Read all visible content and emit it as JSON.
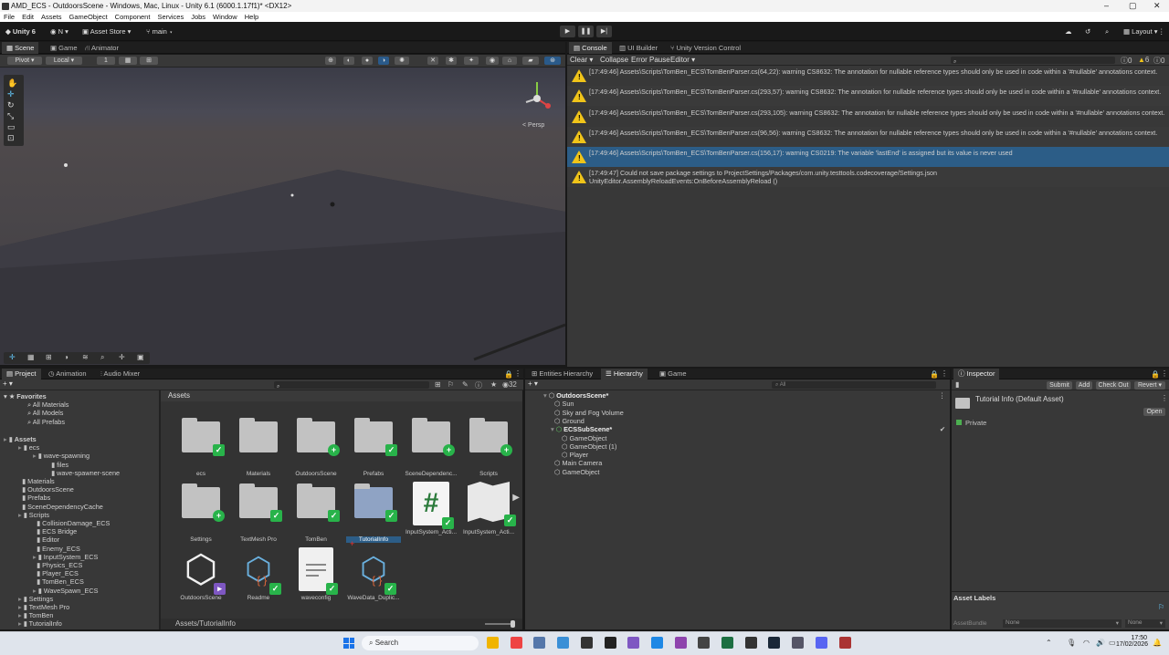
{
  "window": {
    "title": "AMD_ECS - OutdoorsScene - Windows, Mac, Linux - Unity 6.1 (6000.1.17f1)* <DX12>"
  },
  "menu": [
    "File",
    "Edit",
    "Assets",
    "GameObject",
    "Component",
    "Services",
    "Jobs",
    "Window",
    "Help"
  ],
  "toolbar": {
    "unity": "Unity 6",
    "account": "N",
    "asset_store": "Asset Store",
    "branch": "main",
    "layout": "Layout"
  },
  "scene_tabs": [
    "Scene",
    "Game",
    "Animator"
  ],
  "scene_toolbar": {
    "pivot": "Pivot",
    "local": "Local",
    "grid_num": "1",
    "persp": "< Persp"
  },
  "console_tabs": [
    "Console",
    "UI Builder",
    "Unity Version Control"
  ],
  "console_toolbar": {
    "clear": "Clear",
    "collapse": "Collapse",
    "error_pause": "Error Pause",
    "editor": "Editor",
    "err_count": "0",
    "warn_count": "6",
    "info_count": "0"
  },
  "console_rows": [
    {
      "line1": "[17:49:46] Assets\\Scripts\\TomBen_ECS\\TomBenParser.cs(64,22): warning CS8632: The annotation for nullable reference types should only be used in code within a '#nullable' annotations context.",
      "line2": ""
    },
    {
      "line1": "[17:49:46] Assets\\Scripts\\TomBen_ECS\\TomBenParser.cs(293,57): warning CS8632: The annotation for nullable reference types should only be used in code within a '#nullable' annotations context.",
      "line2": ""
    },
    {
      "line1": "[17:49:46] Assets\\Scripts\\TomBen_ECS\\TomBenParser.cs(293,105): warning CS8632: The annotation for nullable reference types should only be used in code within a '#nullable' annotations context.",
      "line2": ""
    },
    {
      "line1": "[17:49:46] Assets\\Scripts\\TomBen_ECS\\TomBenParser.cs(96,56): warning CS8632: The annotation for nullable reference types should only be used in code within a '#nullable' annotations context.",
      "line2": ""
    },
    {
      "line1": "[17:49:46] Assets\\Scripts\\TomBen_ECS\\TomBenParser.cs(156,17): warning CS0219: The variable 'lastEnd' is assigned but its value is never used",
      "line2": ""
    },
    {
      "line1": "[17:49:47] Could not save package settings to ProjectSettings/Packages/com.unity.testtools.codecoverage/Settings.json",
      "line2": "UnityEditor.AssemblyReloadEvents:OnBeforeAssemblyReload ()"
    }
  ],
  "project_tabs": [
    "Project",
    "Animation",
    "Audio Mixer"
  ],
  "favorites": {
    "label": "Favorites",
    "items": [
      "All Materials",
      "All Models",
      "All Prefabs"
    ]
  },
  "tree": [
    {
      "label": "Assets",
      "depth": 0
    },
    {
      "label": "ecs",
      "depth": 1
    },
    {
      "label": "wave-spawning",
      "depth": 2
    },
    {
      "label": "files",
      "depth": 3
    },
    {
      "label": "wave-spawner-scene",
      "depth": 3
    },
    {
      "label": "Materials",
      "depth": 1
    },
    {
      "label": "OutdoorsScene",
      "depth": 1
    },
    {
      "label": "Prefabs",
      "depth": 1
    },
    {
      "label": "SceneDependencyCache",
      "depth": 1
    },
    {
      "label": "Scripts",
      "depth": 1
    },
    {
      "label": "CollisionDamage_ECS",
      "depth": 2
    },
    {
      "label": "ECS Bridge",
      "depth": 2
    },
    {
      "label": "Editor",
      "depth": 2
    },
    {
      "label": "Enemy_ECS",
      "depth": 2
    },
    {
      "label": "InputSystem_ECS",
      "depth": 2
    },
    {
      "label": "Physics_ECS",
      "depth": 2
    },
    {
      "label": "Player_ECS",
      "depth": 2
    },
    {
      "label": "TomBen_ECS",
      "depth": 2
    },
    {
      "label": "WaveSpawn_ECS",
      "depth": 2
    },
    {
      "label": "Settings",
      "depth": 1
    },
    {
      "label": "TextMesh Pro",
      "depth": 1
    },
    {
      "label": "TomBen",
      "depth": 1
    },
    {
      "label": "TutorialInfo",
      "depth": 1
    }
  ],
  "assets": {
    "header": "Assets",
    "count": "32",
    "path": "Assets/TutorialInfo",
    "items": [
      {
        "label": "ecs",
        "kind": "folder",
        "badge": "check"
      },
      {
        "label": "Materials",
        "kind": "folder",
        "badge": ""
      },
      {
        "label": "OutdoorsScene",
        "kind": "folder",
        "badge": "plus"
      },
      {
        "label": "Prefabs",
        "kind": "folder",
        "badge": "check"
      },
      {
        "label": "SceneDependenc...",
        "kind": "folder",
        "badge": "plus"
      },
      {
        "label": "Scripts",
        "kind": "folder",
        "badge": "plus"
      },
      {
        "label": "Settings",
        "kind": "folder",
        "badge": "plus"
      },
      {
        "label": "TextMesh Pro",
        "kind": "folder",
        "badge": "check"
      },
      {
        "label": "TomBen",
        "kind": "folder",
        "badge": "check"
      },
      {
        "label": "TutorialInfo",
        "kind": "folder",
        "badge": "check"
      },
      {
        "label": "InputSystem_Acti...",
        "kind": "script",
        "badge": "check"
      },
      {
        "label": "InputSystem_Acti...",
        "kind": "input",
        "badge": "check"
      },
      {
        "label": "OutdoorsScene",
        "kind": "unity",
        "badge": ""
      },
      {
        "label": "Readme",
        "kind": "cube",
        "badge": "check"
      },
      {
        "label": "waveconfig",
        "kind": "doc",
        "badge": "check"
      },
      {
        "label": "WaveData_Duplic...",
        "kind": "cube",
        "badge": "check"
      }
    ]
  },
  "hierarchy_tabs": [
    "Entities Hierarchy",
    "Hierarchy",
    "Game"
  ],
  "hierarchy": [
    {
      "label": "OutdoorsScene*",
      "depth": 0
    },
    {
      "label": "Sun",
      "depth": 1
    },
    {
      "label": "Sky and Fog Volume",
      "depth": 1
    },
    {
      "label": "Ground",
      "depth": 1
    },
    {
      "label": "ECSSubScene*",
      "depth": 1
    },
    {
      "label": "GameObject",
      "depth": 2
    },
    {
      "label": "GameObject (1)",
      "depth": 2
    },
    {
      "label": "Player",
      "depth": 2
    },
    {
      "label": "Main Camera",
      "depth": 1
    },
    {
      "label": "GameObject",
      "depth": 1
    }
  ],
  "hier_search": "All",
  "inspector": {
    "tab": "Inspector",
    "submit": "Submit",
    "add": "Add",
    "checkout": "Check Out",
    "revert": "Revert",
    "title": "Tutorial Info (Default Asset)",
    "open": "Open",
    "private": "Private",
    "asset_labels": "Asset Labels",
    "asset_bundle": "AssetBundle",
    "none1": "None",
    "none2": "None"
  },
  "taskbar": {
    "search": "Search",
    "time": "17:50",
    "date": "17/02/2026"
  }
}
